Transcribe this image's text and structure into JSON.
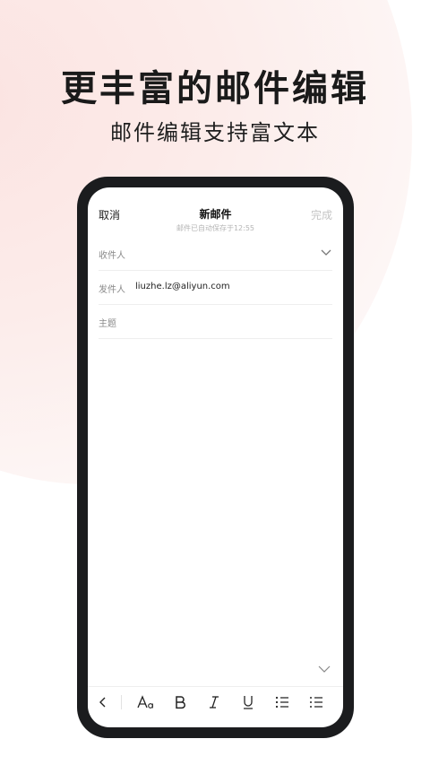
{
  "headline": "更丰富的邮件编辑",
  "subheadline": "邮件编辑支持富文本",
  "compose": {
    "cancel_label": "取消",
    "title": "新邮件",
    "autosave_status": "邮件已自动保存于12:55",
    "done_label": "完成",
    "to_label": "收件人",
    "from_label": "发件人",
    "from_value": "liuzhe.lz@aliyun.com",
    "subject_placeholder": "主题"
  },
  "toolbar": {
    "items": [
      "back-icon",
      "font-size-icon",
      "bold-icon",
      "italic-icon",
      "underline-icon",
      "ordered-list-icon",
      "unordered-list-icon"
    ]
  },
  "colors": {
    "accent_background": "#fbe3e1",
    "phone_frame": "#1b1c1e",
    "done_disabled": "#c4c4c4"
  }
}
